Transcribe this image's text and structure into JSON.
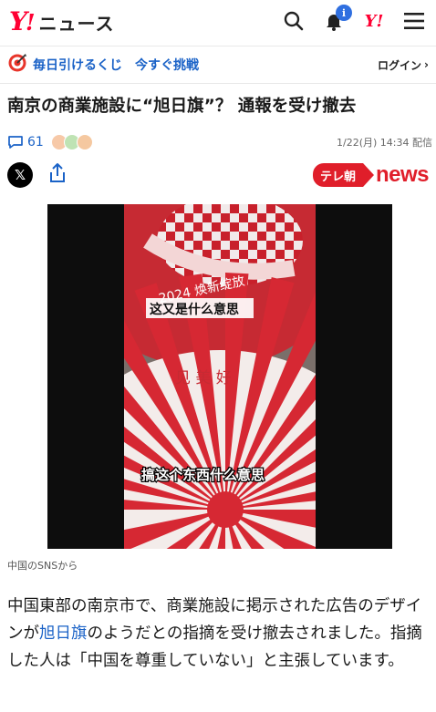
{
  "header": {
    "logo_y": "Y",
    "logo_ex": "!",
    "logo_news": "ニュース",
    "notification_badge": "i",
    "mini_logo": "Y!"
  },
  "lotto": {
    "label": "毎日引けるくじ",
    "cta": "今すぐ挑戦",
    "login": "ログイン",
    "login_chevron": "›"
  },
  "article": {
    "title": "南京の商業施設に“旭日旗”？ 通報を受け撤去",
    "comment_count": "61",
    "date": "1/22(月) 14:34 配信",
    "share_x": "𝕏",
    "source_pill": "テレ朝",
    "source_news": "news",
    "image_caption": "中国のSNSから",
    "video_overlay_top": "这又是什么意思",
    "video_overlay_bottom": "搞这个东西什么意思",
    "sign_text_1": "2024 焕新绽放",
    "sign_text_2": "见 美 好",
    "body_pre": "中国東部の南京市で、商業施設に掲示された広告のデザインが",
    "body_link": "旭日旗",
    "body_post": "のようだとの指摘を受け撤去されました。指摘した人は「中国を尊重していない」と主張しています。"
  },
  "colors": {
    "brand_red": "#ff0033",
    "link_blue": "#1a62c7",
    "tv_red": "#e01e2a"
  }
}
